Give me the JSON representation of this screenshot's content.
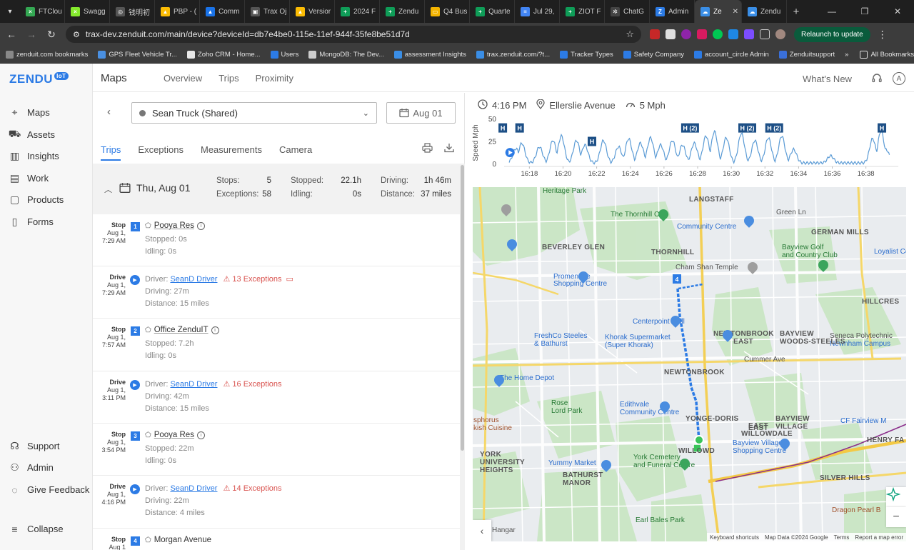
{
  "browser": {
    "tabs": [
      {
        "label": "FTClou",
        "color": "#34a853",
        "glyph": "×"
      },
      {
        "label": "Swagg",
        "color": "#85ea2d",
        "glyph": "×"
      },
      {
        "label": "钱明初",
        "color": "#555555",
        "glyph": "◎"
      },
      {
        "label": "PBP - (",
        "color": "#fbbc04",
        "glyph": "▲"
      },
      {
        "label": "Comm",
        "color": "#1a73e8",
        "glyph": "▲"
      },
      {
        "label": "Trax Oj",
        "color": "#555555",
        "glyph": "▣"
      },
      {
        "label": "Versior",
        "color": "#fbbc04",
        "glyph": "▲"
      },
      {
        "label": "2024 F",
        "color": "#0f9d58",
        "glyph": "+"
      },
      {
        "label": "Zendu",
        "color": "#0f9d58",
        "glyph": "+"
      },
      {
        "label": "Q4 Bus",
        "color": "#f4b400",
        "glyph": "▭"
      },
      {
        "label": "Quarte",
        "color": "#0f9d58",
        "glyph": "+"
      },
      {
        "label": "Jul 29,",
        "color": "#4285f4",
        "glyph": "≡"
      },
      {
        "label": "ZIOT F",
        "color": "#0f9d58",
        "glyph": "+"
      },
      {
        "label": "ChatG",
        "color": "#444444",
        "glyph": "✲"
      },
      {
        "label": "Admin",
        "color": "#2c7be5",
        "glyph": "Z"
      },
      {
        "label": "Ze",
        "color": "#3a8ee6",
        "glyph": "☁",
        "active": true
      },
      {
        "label": "Zendu",
        "color": "#3a8ee6",
        "glyph": "☁"
      }
    ],
    "url": "trax-dev.zenduit.com/main/device?deviceId=db7e4be0-115e-11ef-944f-35fe8be51d7d",
    "relaunch_label": "Relaunch to update",
    "bookmarks": [
      {
        "label": "zenduit.com bookmarks",
        "color": "#888888"
      },
      {
        "label": "GPS Fleet Vehicle Tr...",
        "color": "#4a90e2"
      },
      {
        "label": "Zoho CRM - Home...",
        "color": "#e8e8e8"
      },
      {
        "label": "Users",
        "color": "#2c7be5"
      },
      {
        "label": "MongoDB: The Dev...",
        "color": "#cccccc"
      },
      {
        "label": "assessment Insights",
        "color": "#3a8ee6"
      },
      {
        "label": "trax.zenduit.com/?t...",
        "color": "#3a8ee6"
      },
      {
        "label": "Tracker Types",
        "color": "#2c7be5"
      },
      {
        "label": "Safety Company",
        "color": "#2c7be5"
      },
      {
        "label": "account_circle Admin",
        "color": "#2c7be5"
      },
      {
        "label": "Zenduitsupport",
        "color": "#3a6fd8"
      }
    ],
    "more_bookmarks": "»",
    "all_bookmarks": "All Bookmarks"
  },
  "sidebar": {
    "logo": "ZENDU",
    "logo_badge": "IoT",
    "items": [
      {
        "label": "Maps",
        "icon": "map-pin-icon"
      },
      {
        "label": "Assets",
        "icon": "car-icon"
      },
      {
        "label": "Insights",
        "icon": "bar-chart-icon"
      },
      {
        "label": "Work",
        "icon": "briefcase-icon"
      },
      {
        "label": "Products",
        "icon": "box-icon"
      },
      {
        "label": "Forms",
        "icon": "form-icon"
      }
    ],
    "bottom_items": [
      {
        "label": "Support",
        "icon": "headset-icon"
      },
      {
        "label": "Admin",
        "icon": "people-icon"
      },
      {
        "label": "Give Feedback",
        "icon": "chat-icon"
      },
      {
        "label": "Collapse",
        "icon": "collapse-icon"
      }
    ]
  },
  "header": {
    "title": "Maps",
    "nav": [
      "Overview",
      "Trips",
      "Proximity"
    ],
    "whats_new": "What's New",
    "avatar": "A"
  },
  "left": {
    "device": "Sean Truck (Shared)",
    "date": "Aug 01",
    "tabs": [
      "Trips",
      "Exceptions",
      "Measurements",
      "Camera"
    ],
    "day": {
      "label": "Thu, Aug 01",
      "stops_label": "Stops:",
      "stops": "5",
      "exceptions_label": "Exceptions:",
      "exceptions": "58",
      "stopped_label": "Stopped:",
      "stopped": "22.1h",
      "idling_label": "Idling:",
      "idling": "0s",
      "driving_label": "Driving:",
      "driving": "1h 46m",
      "distance_label": "Distance:",
      "distance": "37 miles"
    },
    "rows": [
      {
        "type": "Stop",
        "date": "Aug 1,",
        "time": "7:29 AM",
        "num": "1",
        "title": "Pooya Res",
        "l1": "Stopped: 0s",
        "l2": "Idling: 0s"
      },
      {
        "type": "Drive",
        "date": "Aug 1,",
        "time": "7:29 AM",
        "driver_prefix": "Driver:",
        "driver": "SeanD Driver",
        "exceptions": "13 Exceptions",
        "l1": "Driving: 27m",
        "l2": "Distance: 15 miles"
      },
      {
        "type": "Stop",
        "date": "Aug 1,",
        "time": "7:57 AM",
        "num": "2",
        "title": "Office ZenduIT",
        "l1": "Stopped: 7.2h",
        "l2": "Idling: 0s"
      },
      {
        "type": "Drive",
        "date": "Aug 1,",
        "time": "3:11 PM",
        "driver_prefix": "Driver:",
        "driver": "SeanD Driver",
        "exceptions": "16 Exceptions",
        "l1": "Driving: 42m",
        "l2": "Distance: 15 miles"
      },
      {
        "type": "Stop",
        "date": "Aug 1,",
        "time": "3:54 PM",
        "num": "3",
        "title": "Pooya Res",
        "l1": "Stopped: 22m",
        "l2": "Idling: 0s"
      },
      {
        "type": "Drive",
        "date": "Aug 1,",
        "time": "4:16 PM",
        "driver_prefix": "Driver:",
        "driver": "SeanD Driver",
        "exceptions": "14 Exceptions",
        "l1": "Driving: 22m",
        "l2": "Distance: 4 miles"
      },
      {
        "type": "Stop",
        "date": "Aug 1",
        "time": "",
        "num": "4",
        "title": "Morgan Avenue",
        "l1": "",
        "l2": ""
      }
    ]
  },
  "right": {
    "time": "4:16 PM",
    "street": "Ellerslie Avenue",
    "speed": "5 Mph",
    "chart": {
      "ylabel": "Speed Mph",
      "yticks": [
        "50",
        "25",
        "0"
      ],
      "xticks": [
        "16:18",
        "16:20",
        "16:22",
        "16:24",
        "16:26",
        "16:28",
        "16:30",
        "16:32",
        "16:34",
        "16:36",
        "16:38"
      ],
      "markers": [
        {
          "label": "H",
          "t": 16.42
        },
        {
          "label": "H",
          "t": 17.42
        },
        {
          "label": "H",
          "t": 21.72
        },
        {
          "label": "H (2)",
          "t": 27.55
        },
        {
          "label": "H (2)",
          "t": 30.95
        },
        {
          "label": "H (2)",
          "t": 32.55
        },
        {
          "label": "H",
          "t": 38.95
        }
      ]
    },
    "map": {
      "labels": [
        {
          "text": "Heritage Park",
          "style": "green"
        },
        {
          "text": "LANGSTAFF",
          "style": "bold"
        },
        {
          "text": "The Thornhill Club",
          "style": "green"
        },
        {
          "text": "Green Ln",
          "style": ""
        },
        {
          "text": "Community Centre",
          "style": "blue"
        },
        {
          "text": "GERMAN MILLS",
          "style": "bold"
        },
        {
          "text": "BEVERLEY GLEN",
          "style": "bold"
        },
        {
          "text": "THORNHILL",
          "style": "bold"
        },
        {
          "text": "Bayview Golf",
          "style": "green"
        },
        {
          "text": "and Country Club",
          "style": "green"
        },
        {
          "text": "Loyalist Colleg",
          "style": "blue"
        },
        {
          "text": "Cham Shan Temple",
          "style": ""
        },
        {
          "text": "Promenade",
          "style": "blue"
        },
        {
          "text": "Shopping Centre",
          "style": "blue"
        },
        {
          "text": "HILLCRES",
          "style": "bold"
        },
        {
          "text": "Centerpoint Mall",
          "style": "blue"
        },
        {
          "text": "Seneca Polytechnic",
          "style": ""
        },
        {
          "text": "Newnham Campus",
          "style": "blue"
        },
        {
          "text": "FreshCo Steeles",
          "style": "blue"
        },
        {
          "text": "& Bathurst",
          "style": "blue"
        },
        {
          "text": "Khorak Supermarket",
          "style": "blue"
        },
        {
          "text": "(Super Khorak)",
          "style": "blue"
        },
        {
          "text": "NEWTONBROOK",
          "style": "bold"
        },
        {
          "text": "EAST",
          "style": "bold"
        },
        {
          "text": "BAYVIEW",
          "style": "bold"
        },
        {
          "text": "WOODS-STEELES",
          "style": "bold"
        },
        {
          "text": "Cummer Ave",
          "style": ""
        },
        {
          "text": "NEWTONBROOK",
          "style": "bold"
        },
        {
          "text": "The Home Depot",
          "style": "blue"
        },
        {
          "text": "Rose",
          "style": "green"
        },
        {
          "text": "Lord Park",
          "style": "green"
        },
        {
          "text": "Edithvale",
          "style": "blue"
        },
        {
          "text": "Community Centre",
          "style": "blue"
        },
        {
          "text": "YONGE-DORIS",
          "style": "bold"
        },
        {
          "text": "EAST",
          "style": "bold"
        },
        {
          "text": "BAYVIEW",
          "style": "bold"
        },
        {
          "text": "VILLAGE",
          "style": "bold"
        },
        {
          "text": "CF Fairview M",
          "style": "blue"
        },
        {
          "text": "sphorus",
          "style": "brown"
        },
        {
          "text": "kish Cuisine",
          "style": "brown"
        },
        {
          "text": "WILLOWD",
          "style": "bold"
        },
        {
          "text": "EAST",
          "style": "bold"
        },
        {
          "text": "WILLOWDALE",
          "style": "bold"
        },
        {
          "text": "Bayview Village",
          "style": "blue"
        },
        {
          "text": "Shopping Centre",
          "style": "blue"
        },
        {
          "text": "HENRY FA",
          "style": "bold"
        },
        {
          "text": "YORK",
          "style": "bold"
        },
        {
          "text": "UNIVERSITY",
          "style": "bold"
        },
        {
          "text": "HEIGHTS",
          "style": "bold"
        },
        {
          "text": "Yummy Market",
          "style": "blue"
        },
        {
          "text": "York Cemetery",
          "style": "green"
        },
        {
          "text": "and Funeral Centre",
          "style": "green"
        },
        {
          "text": "BATHURST",
          "style": "bold"
        },
        {
          "text": "MANOR",
          "style": "bold"
        },
        {
          "text": "SILVER HILLS",
          "style": "bold"
        },
        {
          "text": "Dragon Pearl B",
          "style": "brown"
        },
        {
          "text": "Earl Bales Park",
          "style": "green"
        },
        {
          "text": "ogle",
          "style": ""
        },
        {
          "text": "Hangar",
          "style": ""
        }
      ],
      "route_marker": "4",
      "footer": [
        "Keyboard shortcuts",
        "Map Data ©2024 Google",
        "Terms",
        "Report a map error"
      ],
      "zoom_out": "−"
    }
  }
}
